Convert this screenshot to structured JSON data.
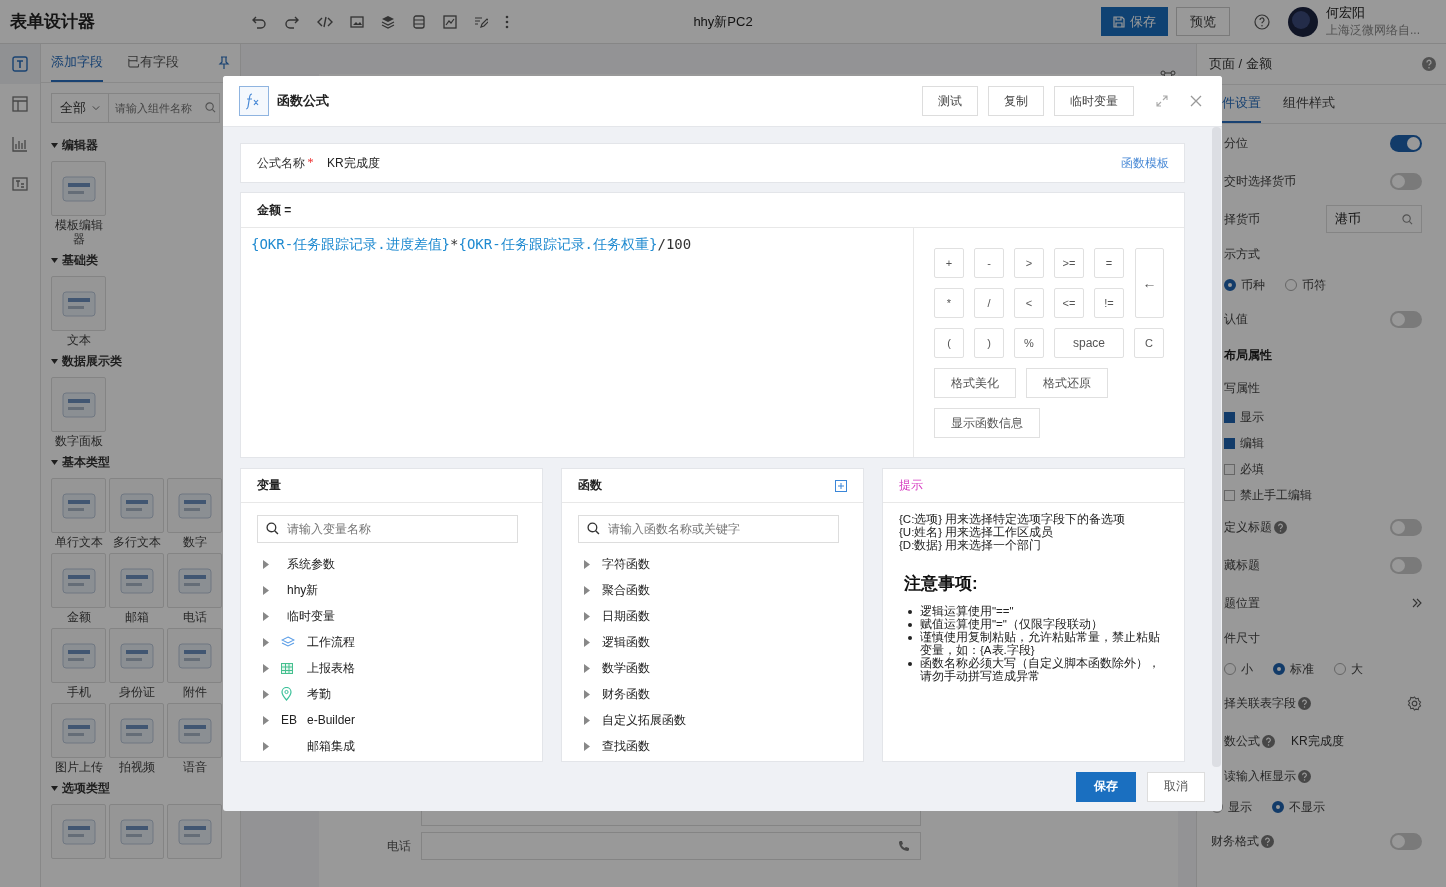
{
  "app": {
    "title": "表单设计器",
    "page_title": "hhy新PC2",
    "save_label": "保存",
    "preview_label": "预览",
    "user": {
      "name": "何宏阳",
      "org": "上海泛微网络自..."
    }
  },
  "rail": [
    {
      "selected": true
    },
    {
      "selected": false
    },
    {
      "selected": false
    },
    {
      "selected": false
    }
  ],
  "left_panel": {
    "tabs": [
      {
        "label": "添加字段",
        "selected": true
      },
      {
        "label": "已有字段",
        "selected": false
      }
    ],
    "filter": "全部",
    "search_placeholder": "请输入组件名称",
    "groups": [
      {
        "title": "编辑器",
        "items": [
          {
            "kind": "tile",
            "label": "模板编辑器"
          }
        ]
      },
      {
        "title": "基础类",
        "items": [
          {
            "kind": "tile",
            "label": "文本"
          }
        ]
      },
      {
        "title": "数据展示类",
        "items": [
          {
            "kind": "tile",
            "label": "数字面板"
          }
        ]
      },
      {
        "title": "基本类型",
        "items": [
          {
            "kind": "tile",
            "label": "单行文本"
          },
          {
            "kind": "tile",
            "label": "多行文本"
          },
          {
            "kind": "tile",
            "label": "数字"
          },
          {
            "kind": "tile",
            "label": "金额"
          },
          {
            "kind": "tile",
            "label": "邮箱"
          },
          {
            "kind": "tile",
            "label": "电话"
          },
          {
            "kind": "tile",
            "label": "手机"
          },
          {
            "kind": "tile",
            "label": "身份证"
          },
          {
            "kind": "tile",
            "label": "附件"
          },
          {
            "kind": "tile",
            "label": "图片上传"
          },
          {
            "kind": "tile",
            "label": "拍视频"
          },
          {
            "kind": "tile",
            "label": "语音"
          }
        ]
      },
      {
        "title": "选项类型",
        "items": [
          {
            "kind": "cut"
          },
          {
            "kind": "cut"
          },
          {
            "kind": "cut"
          }
        ]
      }
    ]
  },
  "canvas": {
    "fields": [
      {
        "kind": "blank"
      },
      {
        "kind": "phone",
        "label": "电话"
      }
    ]
  },
  "right_panel": {
    "breadcrumb": "页面 / 金额",
    "tabs": [
      {
        "label": "件设置",
        "selected": true
      },
      {
        "label": "组件样式",
        "selected": false
      }
    ],
    "rows": [
      {
        "kind": "toggle",
        "label": "分位",
        "help": false,
        "on": true
      },
      {
        "kind": "toggle",
        "label": "交时选择货币",
        "help": false,
        "on": false
      },
      {
        "kind": "select",
        "label": "择货币",
        "help": false,
        "value": "港币"
      },
      {
        "kind": "label",
        "label": "示方式",
        "help": false
      },
      {
        "kind": "radios",
        "options": [
          {
            "label": "币种",
            "selected": true
          },
          {
            "label": "币符",
            "selected": false
          }
        ]
      },
      {
        "kind": "toggle",
        "label": "认值",
        "help": false,
        "on": false
      },
      {
        "kind": "heading",
        "label": "布局属性",
        "help": false
      },
      {
        "kind": "label",
        "label": "写属性",
        "help": false
      },
      {
        "kind": "checkbox",
        "label": "显示",
        "checked": true
      },
      {
        "kind": "checkbox",
        "label": "编辑",
        "checked": true
      },
      {
        "kind": "checkbox",
        "label": "必填",
        "checked": false
      },
      {
        "kind": "checkbox",
        "label": "禁止手工编辑",
        "checked": false
      },
      {
        "kind": "toggle",
        "label": "定义标题",
        "help": true,
        "on": false
      },
      {
        "kind": "toggle",
        "label": "藏标题",
        "help": false,
        "on": false
      },
      {
        "kind": "chevron",
        "label": "题位置",
        "help": false
      },
      {
        "kind": "label",
        "label": "件尺寸",
        "help": false
      },
      {
        "kind": "radios",
        "options": [
          {
            "label": "小",
            "selected": false
          },
          {
            "label": "标准",
            "selected": true
          },
          {
            "label": "大",
            "selected": false
          }
        ]
      },
      {
        "kind": "gear",
        "label": "择关联表字段",
        "help": true
      },
      {
        "kind": "value",
        "label": "数公式",
        "help": true,
        "value": "KR完成度"
      },
      {
        "kind": "label",
        "label": "读输入框显示",
        "help": true
      },
      {
        "kind": "radios",
        "options": [
          {
            "label": "显示",
            "selected": false
          },
          {
            "label": "不显示",
            "selected": true
          }
        ]
      },
      {
        "kind": "toggle",
        "label": "财务格式",
        "help": true,
        "on": false
      }
    ]
  },
  "dialog": {
    "title": "函数公式",
    "actions": [
      "测试",
      "复制",
      "临时变量"
    ],
    "name_label": "公式名称",
    "required": true,
    "name_value": "KR完成度",
    "template_link": "函数模板",
    "target": "金额 =",
    "formula": [
      {
        "kind": "field",
        "text": "{OKR-任务跟踪记录.进度差值}"
      },
      {
        "kind": "op",
        "text": "*"
      },
      {
        "kind": "field",
        "text": "{OKR-任务跟踪记录.任务权重}"
      },
      {
        "kind": "op",
        "text": "/100"
      }
    ],
    "keys": [
      {
        "kind": "key",
        "label": "+"
      },
      {
        "kind": "key",
        "label": "-"
      },
      {
        "kind": "key",
        "label": ">"
      },
      {
        "kind": "key",
        "label": ">="
      },
      {
        "kind": "key",
        "label": "="
      },
      {
        "kind": "tall",
        "label": "←"
      },
      {
        "kind": "key",
        "label": "*"
      },
      {
        "kind": "key",
        "label": "/"
      },
      {
        "kind": "key",
        "label": "<"
      },
      {
        "kind": "key",
        "label": "<="
      },
      {
        "kind": "key",
        "label": "!="
      },
      {
        "kind": "key",
        "label": "("
      },
      {
        "kind": "key",
        "label": ")"
      },
      {
        "kind": "key",
        "label": "%"
      },
      {
        "kind": "wide",
        "label": "space"
      },
      {
        "kind": "key",
        "label": "C"
      }
    ],
    "format_buttons": [
      "格式美化",
      "格式还原"
    ],
    "info_button": "显示函数信息",
    "variables": {
      "title": "变量",
      "placeholder": "请输入变量名称",
      "items": [
        {
          "kind": "plain",
          "label": "系统参数"
        },
        {
          "kind": "plain",
          "label": "hhy新"
        },
        {
          "kind": "plain",
          "label": "临时变量"
        },
        {
          "kind": "workflow",
          "label": "工作流程"
        },
        {
          "kind": "table",
          "label": "上报表格"
        },
        {
          "kind": "location",
          "label": "考勤"
        },
        {
          "kind": "badge",
          "badge": "EB",
          "label": "e-Builder"
        },
        {
          "kind": "blank",
          "label": "邮箱集成"
        }
      ]
    },
    "functions": {
      "title": "函数",
      "placeholder": "请输入函数名称或关键字",
      "items": [
        "字符函数",
        "聚合函数",
        "日期函数",
        "逻辑函数",
        "数学函数",
        "财务函数",
        "自定义拓展函数",
        "查找函数"
      ]
    },
    "hints": {
      "title": "提示",
      "lines": [
        "{C:选项} 用来选择特定选项字段下的备选项",
        "{U:姓名} 用来选择工作区成员",
        "{D:数据} 用来选择一个部门"
      ],
      "notice_title": "注意事项:",
      "notices": [
        "逻辑运算使用\"==\"",
        "赋值运算使用\"=\"（仅限字段联动）",
        "谨慎使用复制粘贴，允许粘贴常量，禁止粘贴变量，如：{A表.字段}",
        "函数名称必须大写（自定义脚本函数除外），请勿手动拼写造成异常"
      ]
    },
    "buttons": [
      "保存",
      "取消"
    ]
  }
}
